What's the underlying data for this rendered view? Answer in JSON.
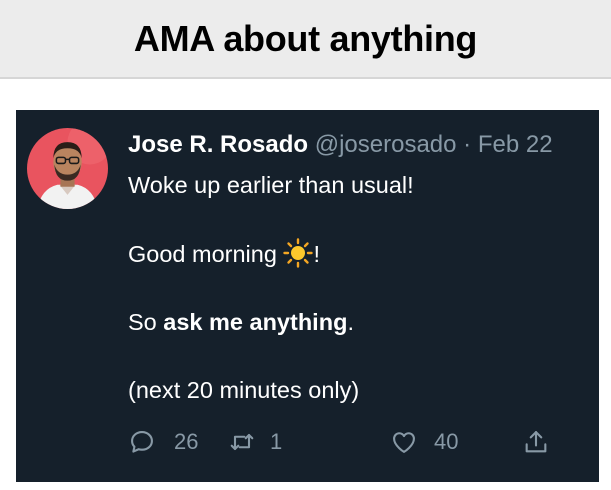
{
  "header": {
    "title": "AMA about anything"
  },
  "tweet": {
    "author": {
      "name": "Jose R. Rosado",
      "handle": "@joserosado",
      "separator": "·",
      "date": "Feb 22"
    },
    "lines": {
      "line1": "Woke up earlier than usual!",
      "line2_before": "Good morning ",
      "line2_after": "!",
      "line3_before": "So ",
      "line3_bold": "ask me anything",
      "line3_after": ".",
      "line4": "(next 20 minutes only)"
    },
    "emoji": "sun-icon",
    "actions": {
      "replies": "26",
      "retweets": "1",
      "likes": "40"
    }
  },
  "colors": {
    "tweet_background": "#15202b",
    "secondary_text": "#8899a6",
    "avatar_background": "#e9545f"
  }
}
